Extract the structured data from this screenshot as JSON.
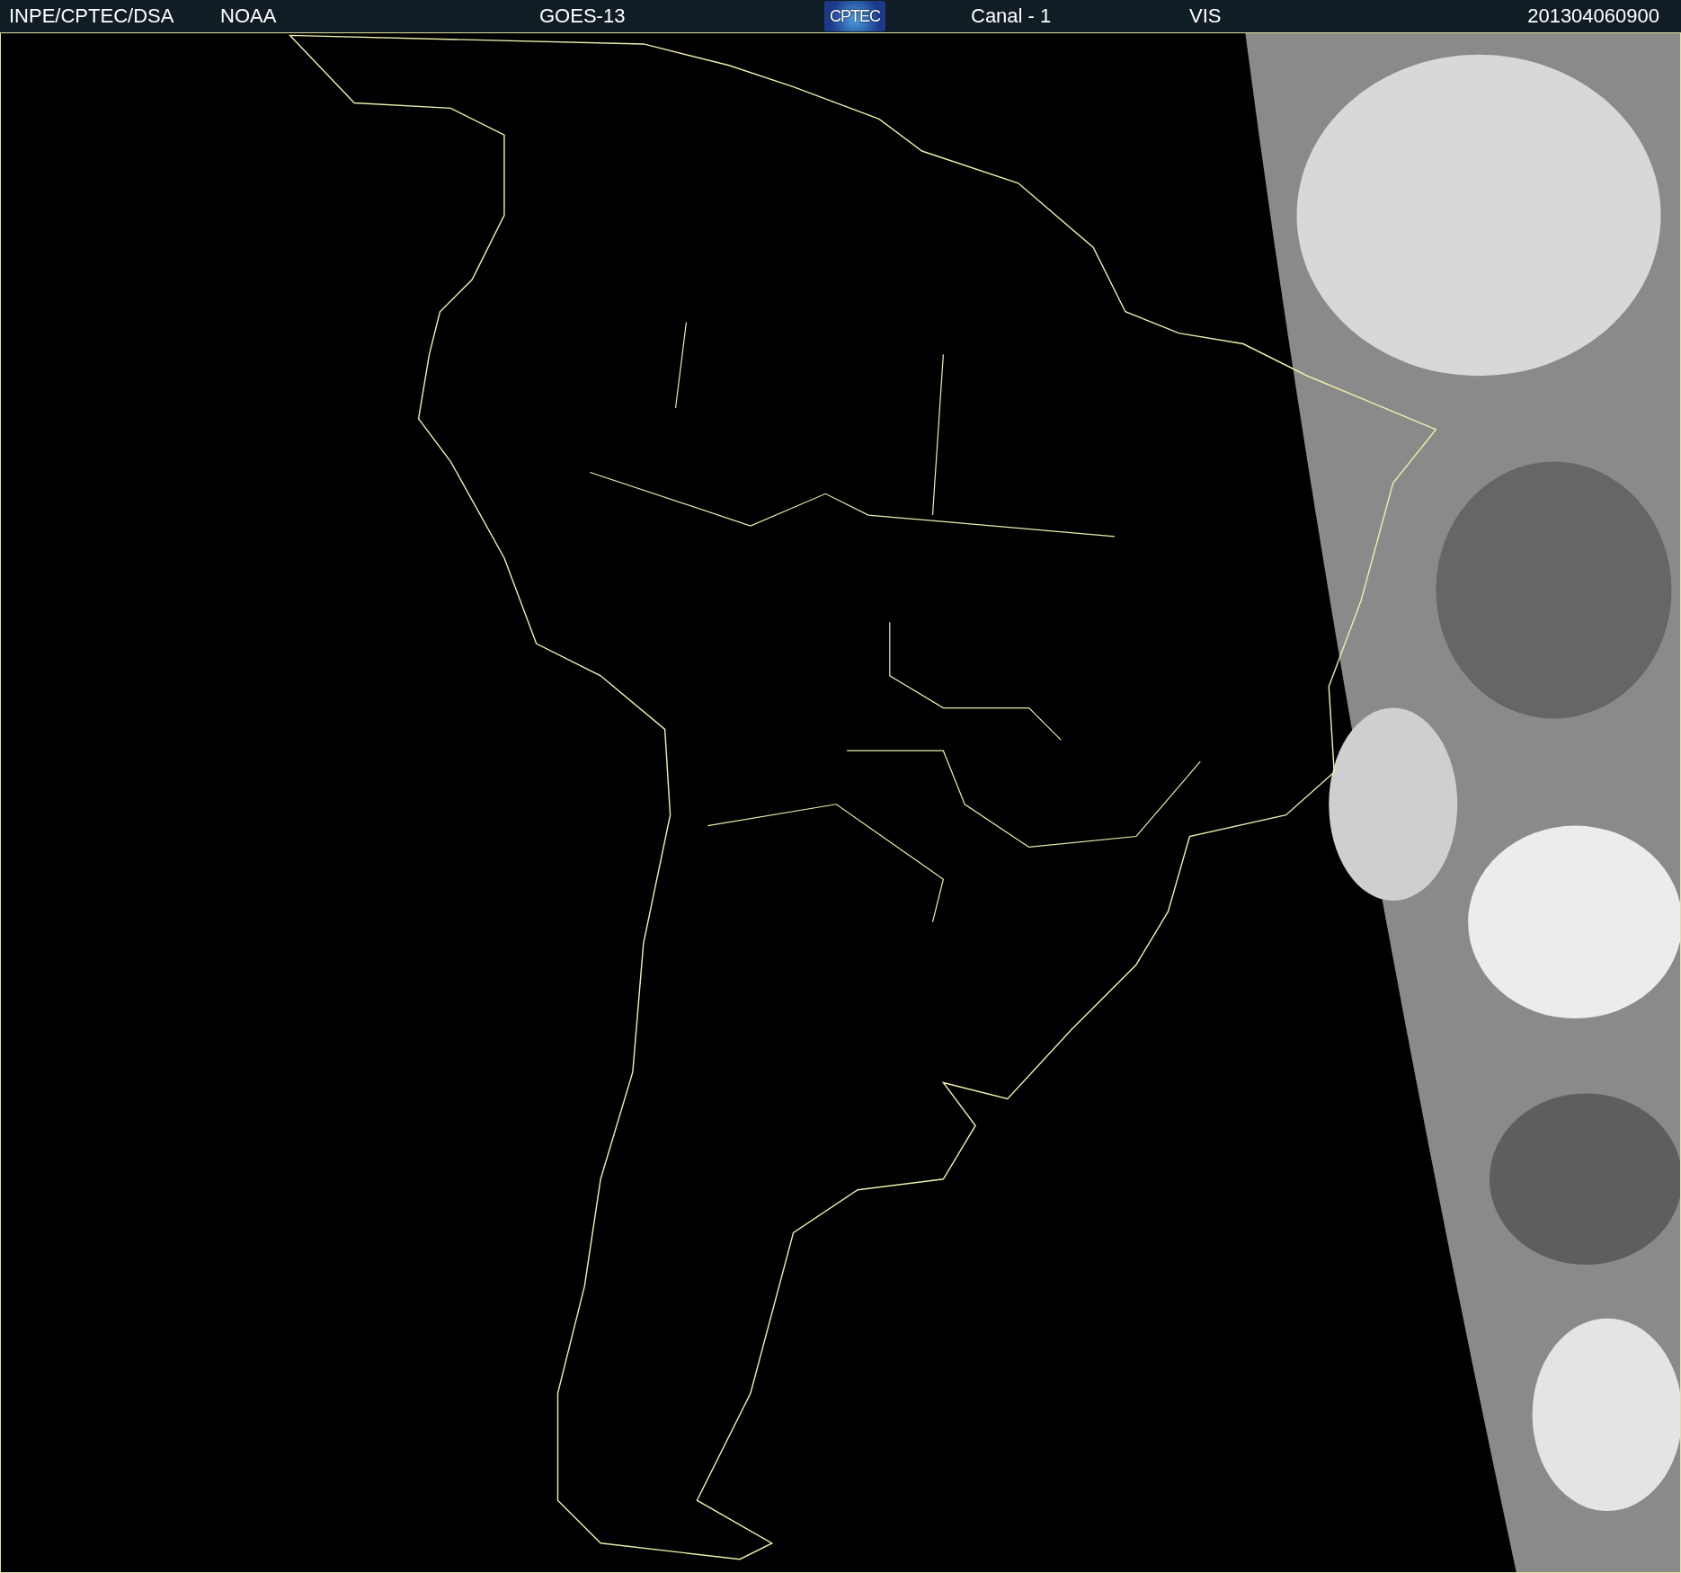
{
  "header": {
    "items": [
      {
        "kind": "text",
        "text": "INPE/CPTEC/DSA"
      },
      {
        "kind": "text",
        "text": "NOAA"
      },
      {
        "kind": "text",
        "text": "GOES-13"
      },
      {
        "kind": "logo",
        "text": "CPTEC"
      },
      {
        "kind": "text",
        "text": "Canal - 1"
      },
      {
        "kind": "text",
        "text": "VIS"
      },
      {
        "kind": "date",
        "text": "201304060900"
      }
    ]
  }
}
